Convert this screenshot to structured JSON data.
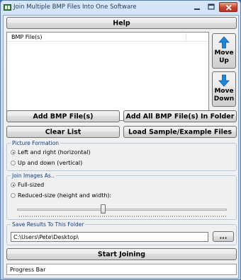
{
  "window": {
    "title": "Join Multiple BMP Files Into One Software"
  },
  "toolbar": {
    "help_label": "Help"
  },
  "file_list": {
    "column_header": "BMP File(s)",
    "items": []
  },
  "side_buttons": {
    "move_up_line1": "Move",
    "move_up_line2": "Up",
    "move_down_line1": "Move",
    "move_down_line2": "Down"
  },
  "actions": {
    "add_files": "Add BMP File(s)",
    "add_folder": "Add All BMP File(s) In Folder",
    "clear_list": "Clear List",
    "load_sample": "Load Sample/Example Files"
  },
  "picture_formation": {
    "title": "Picture Formation",
    "options": [
      {
        "label": "Left and right (horizontal)",
        "checked": true
      },
      {
        "label": "Up and down (vertical)",
        "checked": false
      }
    ]
  },
  "join_as": {
    "title": "Join Images As..",
    "options": [
      {
        "label": "Full-sized",
        "checked": true
      },
      {
        "label": "Reduced-size (height and width):",
        "checked": false
      }
    ],
    "slider_level": 0.41
  },
  "save": {
    "title": "Save Results To This Folder",
    "path": "C:\\Users\\Pete\\Desktop\\",
    "browse_label": "..."
  },
  "start_label": "Start Joining",
  "progress_label": "Progress Bar",
  "colors": {
    "accent_arrow": "#1e86d6",
    "group_title": "#0a3a8a",
    "title_bar": "#c3d8f1"
  }
}
